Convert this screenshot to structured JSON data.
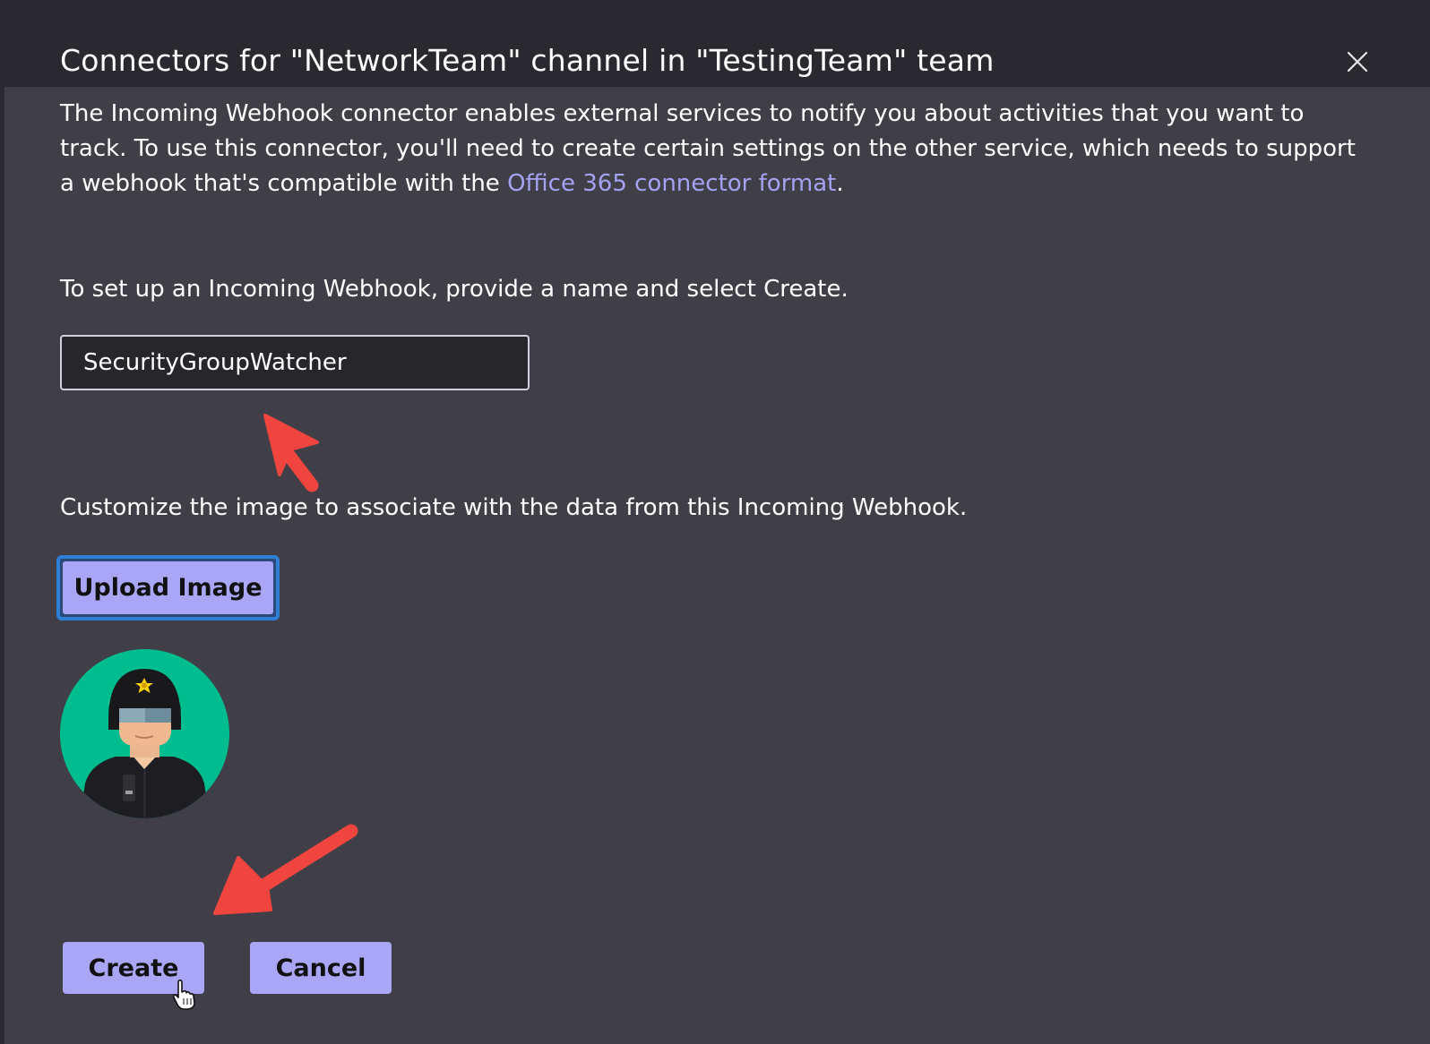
{
  "dialog": {
    "title": "Connectors for \"NetworkTeam\" channel in \"TestingTeam\" team",
    "close_icon": "close-icon"
  },
  "intro": {
    "text_before_link": "The Incoming Webhook connector enables external services to notify you about activities that you want to track. To use this connector, you'll need to create certain settings on the other service, which needs to support a webhook that's compatible with the ",
    "link_text": "Office 365 connector format",
    "text_after_link": "."
  },
  "setup": {
    "instruction": "To set up an Incoming Webhook, provide a name and select Create.",
    "name_value": "SecurityGroupWatcher"
  },
  "image": {
    "instruction": "Customize the image to associate with the data from this Incoming Webhook.",
    "upload_label": "Upload Image",
    "avatar_icon": "security-guard-avatar-icon"
  },
  "actions": {
    "create_label": "Create",
    "cancel_label": "Cancel"
  },
  "colors": {
    "background": "#403f47",
    "header": "#2a292f",
    "accent_button": "#a9a7f5",
    "link": "#a4a2f2",
    "annotation_arrow": "#f0453f",
    "avatar_background": "#00bd8f"
  }
}
